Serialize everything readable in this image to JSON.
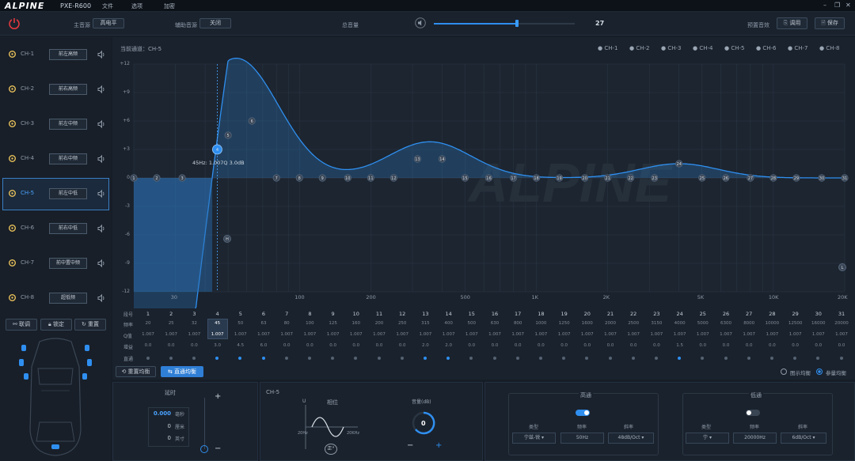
{
  "titlebar": {
    "model": "PXE-R600",
    "menus": [
      "文件",
      "选项",
      "加密"
    ]
  },
  "topbar": {
    "main_label": "主音源",
    "main_value": "高电平",
    "aux_label": "辅助音源",
    "aux_value": "关闭",
    "volume_label": "总音量",
    "volume_value": "27",
    "volume_level": 0.59,
    "preset_label": "预置音效",
    "call_label": "调用",
    "save_label": "保存"
  },
  "channels": [
    {
      "name": "CH-1",
      "pos": "前左高频"
    },
    {
      "name": "CH-2",
      "pos": "前右高频"
    },
    {
      "name": "CH-3",
      "pos": "前左中频"
    },
    {
      "name": "CH-4",
      "pos": "前右中频"
    },
    {
      "name": "CH-5",
      "pos": "前左中低"
    },
    {
      "name": "CH-6",
      "pos": "前右中低"
    },
    {
      "name": "CH-7",
      "pos": "前中置中频"
    },
    {
      "name": "CH-8",
      "pos": "超低频"
    }
  ],
  "sidebar_buttons": {
    "link": "联调",
    "lock": "锁定",
    "reset": "重置"
  },
  "eq": {
    "current_label": "当前通道：CH-5",
    "legend": [
      "CH-1",
      "CH-2",
      "CH-3",
      "CH-4",
      "CH-5",
      "CH-6",
      "CH-7",
      "CH-8"
    ],
    "y_ticks": [
      "+12",
      "+9",
      "+6",
      "+3",
      "0",
      "-3",
      "-6",
      "-9",
      "-12"
    ],
    "x_ticks": [
      "30",
      "100",
      "200",
      "500",
      "1K",
      "2K",
      "5K",
      "10K",
      "20K"
    ],
    "tooltip": "45Hz: 1.007Q 3.0dB",
    "hp_marker": "H",
    "lp_marker": "L",
    "nodes": [
      "1",
      "2",
      "3",
      "4",
      "5",
      "6",
      "7",
      "8",
      "9",
      "10",
      "11",
      "12",
      "13",
      "14",
      "15",
      "16",
      "17",
      "18",
      "19",
      "20",
      "21",
      "22",
      "23",
      "24",
      "25",
      "26",
      "27",
      "28",
      "29",
      "30",
      "31"
    ]
  },
  "table": {
    "row_labels": [
      "段号",
      "频率",
      "Q值",
      "增益",
      "直通"
    ],
    "bands": [
      "1",
      "2",
      "3",
      "4",
      "5",
      "6",
      "7",
      "8",
      "9",
      "10",
      "11",
      "12",
      "13",
      "14",
      "15",
      "16",
      "17",
      "18",
      "19",
      "20",
      "21",
      "22",
      "23",
      "24",
      "25",
      "26",
      "27",
      "28",
      "29",
      "30",
      "31"
    ],
    "freqs": [
      "20",
      "25",
      "32",
      "45",
      "50",
      "63",
      "80",
      "100",
      "125",
      "160",
      "200",
      "250",
      "315",
      "400",
      "500",
      "630",
      "800",
      "1000",
      "1250",
      "1600",
      "2000",
      "2500",
      "3150",
      "4000",
      "5000",
      "6300",
      "8000",
      "10000",
      "12500",
      "16000",
      "20000"
    ],
    "q": "1.007",
    "gains": [
      "0.0",
      "0.0",
      "0.0",
      "3.0",
      "4.5",
      "6.0",
      "0.0",
      "0.0",
      "0.0",
      "0.0",
      "0.0",
      "0.0",
      "2.0",
      "2.0",
      "0.0",
      "0.0",
      "0.0",
      "0.0",
      "0.0",
      "0.0",
      "0.0",
      "0.0",
      "0.0",
      "1.5",
      "0.0",
      "0.0",
      "0.0",
      "0.0",
      "0.0",
      "0.0",
      "0.0"
    ],
    "selected_freq": "45",
    "selected_q": "1.007"
  },
  "eq_buttons": {
    "reset_eq": "重置均衡",
    "bypass_eq": "直通均衡",
    "graphic": "图示均衡",
    "param": "参量均衡"
  },
  "delay": {
    "title": "延时",
    "ms_value": "0.000",
    "ms_unit": "毫秒",
    "cm_value": "0",
    "cm_unit": "厘米",
    "in_value": "0",
    "in_unit": "英寸",
    "plus": "+",
    "minus": "−"
  },
  "phase": {
    "ch": "CH-5",
    "title": "相位",
    "u": "U",
    "lo": "20Hz",
    "hi": "20KHz",
    "state": "正"
  },
  "gain": {
    "title": "音量(dB)",
    "value": "0",
    "minus": "−",
    "plus": "+"
  },
  "hp": {
    "title": "高通",
    "type_label": "类型",
    "freq_label": "频率",
    "slope_label": "斜率",
    "type": "宁兹-锐",
    "freq": "50Hz",
    "slope": "48dB/Oct"
  },
  "lp": {
    "title": "低通",
    "type_label": "类型",
    "freq_label": "频率",
    "slope_label": "斜率",
    "type": "宁",
    "freq": "20000Hz",
    "slope": "6dB/Oct"
  }
}
